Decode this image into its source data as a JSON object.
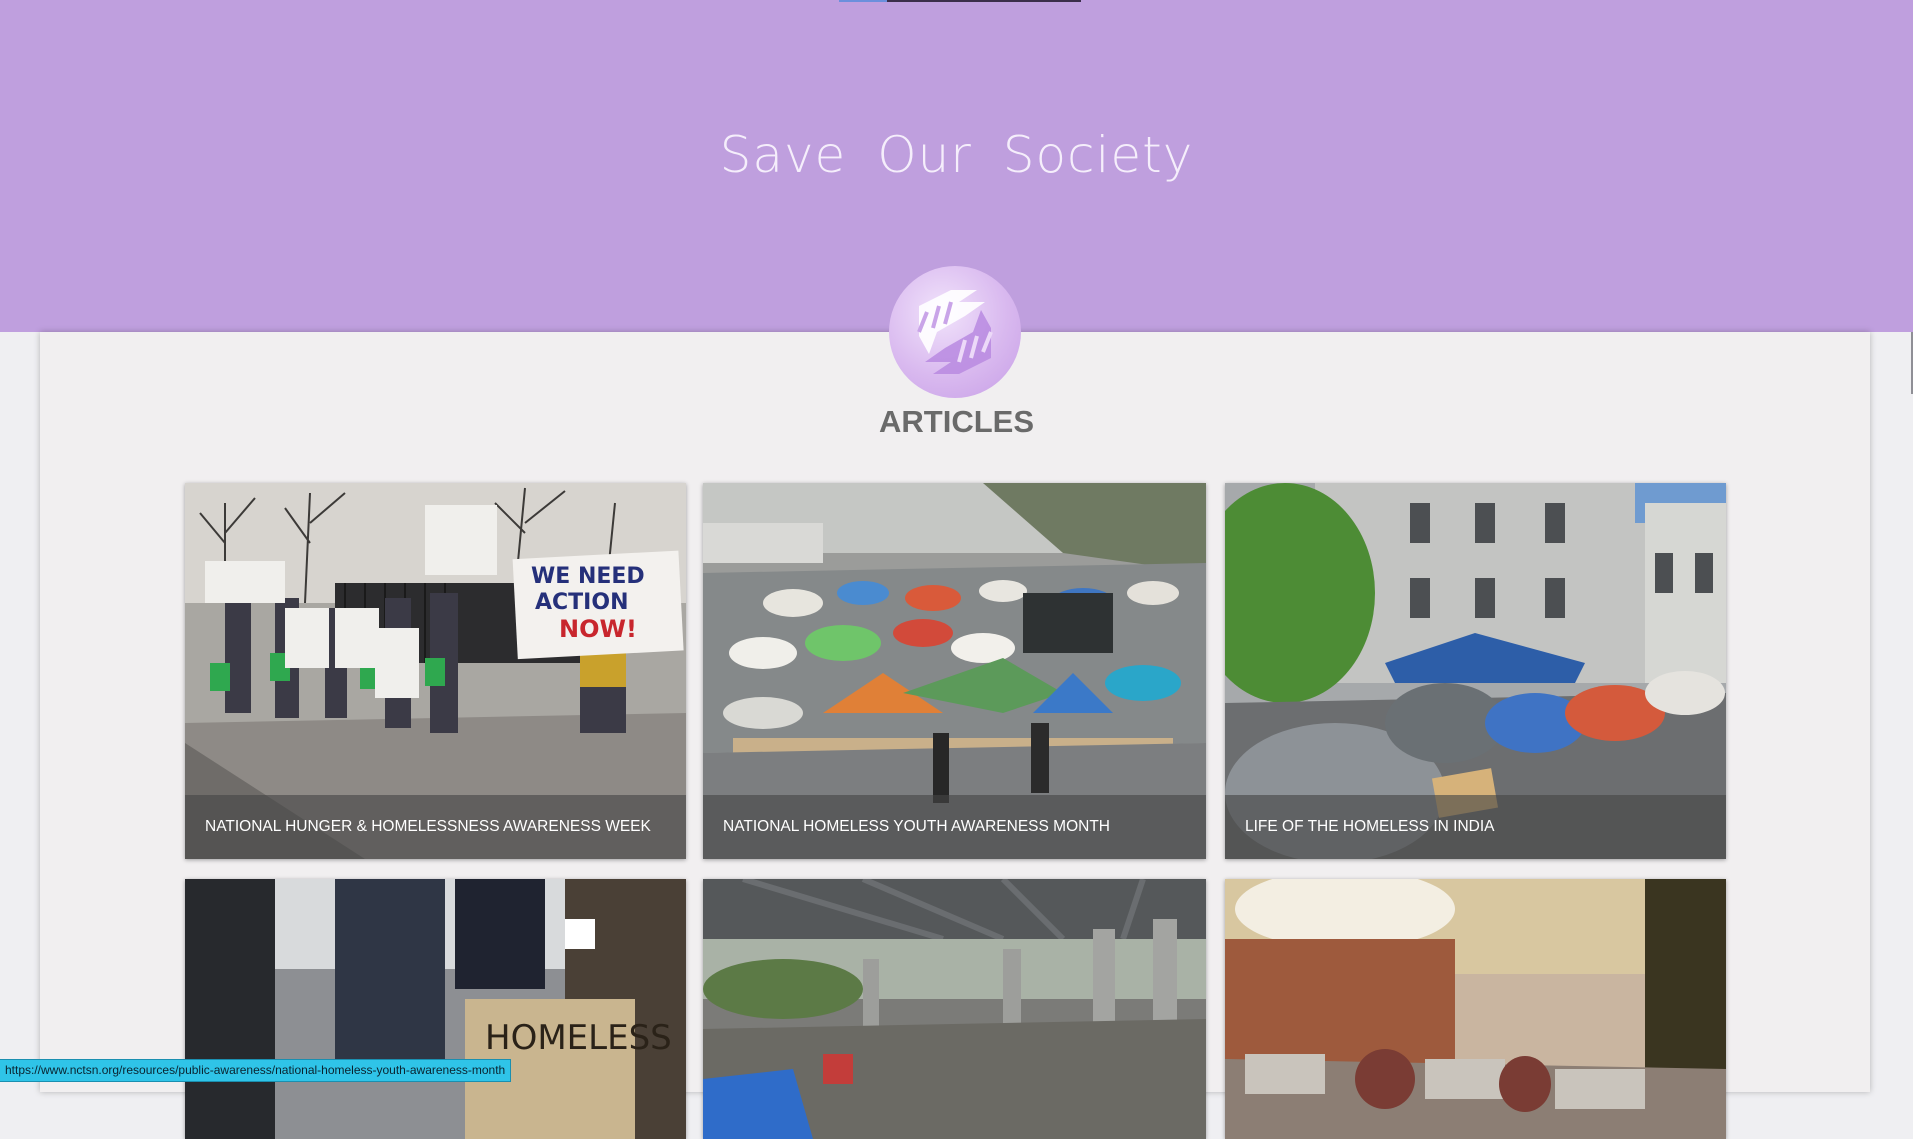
{
  "site": {
    "title": "Save Our Society",
    "section_heading": "ARTICLES",
    "reading_progress_percent": 20
  },
  "logo": {
    "icon": "helping-hands-icon"
  },
  "articles": [
    {
      "title": "NATIONAL HUNGER & HOMELESSNESS AWARENESS WEEK"
    },
    {
      "title": "NATIONAL HOMELESS YOUTH AWARENESS MONTH"
    },
    {
      "title": "LIFE OF THE HOMELESS IN INDIA"
    },
    {
      "title": ""
    },
    {
      "title": ""
    },
    {
      "title": ""
    }
  ],
  "status_bar": {
    "hover_url": "https://www.nctsn.org/resources/public-awareness/national-homeless-youth-awareness-month"
  },
  "colors": {
    "hero_background": "#bf9fde",
    "panel_background": "#f1eff0",
    "status_background": "#2fc4e8"
  }
}
